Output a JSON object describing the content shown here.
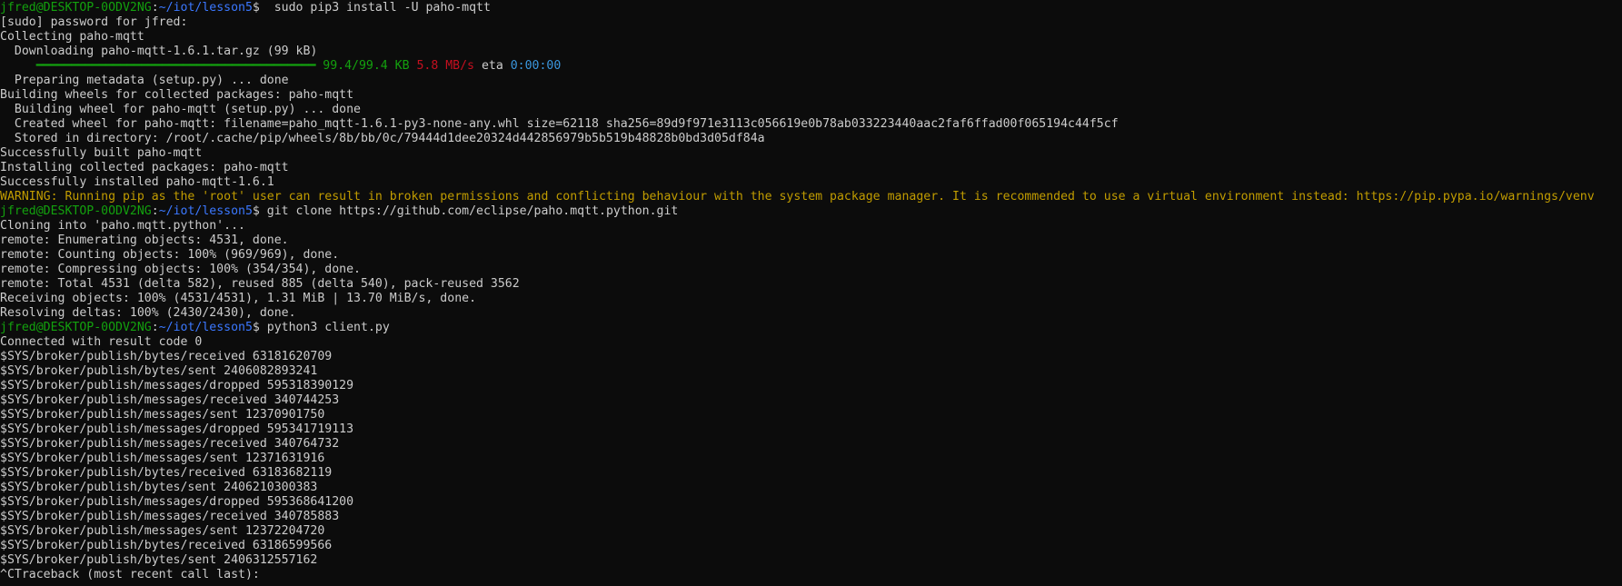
{
  "terminal": {
    "lines": [
      [
        {
          "t": "jfred@DESKTOP-0ODV2NG",
          "c": "green"
        },
        {
          "t": ":",
          "c": "default"
        },
        {
          "t": "~/iot/lesson5",
          "c": "blue"
        },
        {
          "t": "$  sudo pip3 install -U paho-mqtt",
          "c": "default"
        }
      ],
      [
        {
          "t": "[sudo] password for jfred:",
          "c": "default"
        }
      ],
      [
        {
          "t": "Collecting paho-mqtt",
          "c": "default"
        }
      ],
      [
        {
          "t": "  Downloading paho-mqtt-1.6.1.tar.gz (99 kB)",
          "c": "default"
        }
      ],
      [
        {
          "t": "     ",
          "c": "default"
        },
        {
          "t": "━━━━━━━━━━━━━━━━━━━━━━━━━━━━━━━━━━━━━━━━",
          "c": "bar"
        },
        {
          "t": " ",
          "c": "default"
        },
        {
          "t": "99.4/99.4 KB",
          "c": "green"
        },
        {
          "t": " ",
          "c": "default"
        },
        {
          "t": "5.8 MB/s",
          "c": "red"
        },
        {
          "t": " eta ",
          "c": "default"
        },
        {
          "t": "0:00:00",
          "c": "cyan"
        }
      ],
      [
        {
          "t": "  Preparing metadata (setup.py) ... done",
          "c": "default"
        }
      ],
      [
        {
          "t": "Building wheels for collected packages: paho-mqtt",
          "c": "default"
        }
      ],
      [
        {
          "t": "  Building wheel for paho-mqtt (setup.py) ... done",
          "c": "default"
        }
      ],
      [
        {
          "t": "  Created wheel for paho-mqtt: filename=paho_mqtt-1.6.1-py3-none-any.whl size=62118 sha256=89d9f971e3113c056619e0b78ab033223440aac2faf6ffad00f065194c44f5cf",
          "c": "default"
        }
      ],
      [
        {
          "t": "  Stored in directory: /root/.cache/pip/wheels/8b/bb/0c/79444d1dee20324d442856979b5b519b48828b0bd3d05df84a",
          "c": "default"
        }
      ],
      [
        {
          "t": "Successfully built paho-mqtt",
          "c": "default"
        }
      ],
      [
        {
          "t": "Installing collected packages: paho-mqtt",
          "c": "default"
        }
      ],
      [
        {
          "t": "Successfully installed paho-mqtt-1.6.1",
          "c": "default"
        }
      ],
      [
        {
          "t": "WARNING: Running pip as the 'root' user can result in broken permissions and conflicting behaviour with the system package manager. It is recommended to use a virtual environment instead: https://pip.pypa.io/warnings/venv",
          "c": "yellow"
        }
      ],
      [
        {
          "t": "jfred@DESKTOP-0ODV2NG",
          "c": "green"
        },
        {
          "t": ":",
          "c": "default"
        },
        {
          "t": "~/iot/lesson5",
          "c": "blue"
        },
        {
          "t": "$ git clone https://github.com/eclipse/paho.mqtt.python.git",
          "c": "default"
        }
      ],
      [
        {
          "t": "Cloning into 'paho.mqtt.python'...",
          "c": "default"
        }
      ],
      [
        {
          "t": "remote: Enumerating objects: 4531, done.",
          "c": "default"
        }
      ],
      [
        {
          "t": "remote: Counting objects: 100% (969/969), done.",
          "c": "default"
        }
      ],
      [
        {
          "t": "remote: Compressing objects: 100% (354/354), done.",
          "c": "default"
        }
      ],
      [
        {
          "t": "remote: Total 4531 (delta 582), reused 885 (delta 540), pack-reused 3562",
          "c": "default"
        }
      ],
      [
        {
          "t": "Receiving objects: 100% (4531/4531), 1.31 MiB | 13.70 MiB/s, done.",
          "c": "default"
        }
      ],
      [
        {
          "t": "Resolving deltas: 100% (2430/2430), done.",
          "c": "default"
        }
      ],
      [
        {
          "t": "jfred@DESKTOP-0ODV2NG",
          "c": "green"
        },
        {
          "t": ":",
          "c": "default"
        },
        {
          "t": "~/iot/lesson5",
          "c": "blue"
        },
        {
          "t": "$ python3 client.py",
          "c": "default"
        }
      ],
      [
        {
          "t": "Connected with result code 0",
          "c": "default"
        }
      ],
      [
        {
          "t": "$SYS/broker/publish/bytes/received 63181620709",
          "c": "default"
        }
      ],
      [
        {
          "t": "$SYS/broker/publish/bytes/sent 2406082893241",
          "c": "default"
        }
      ],
      [
        {
          "t": "$SYS/broker/publish/messages/dropped 595318390129",
          "c": "default"
        }
      ],
      [
        {
          "t": "$SYS/broker/publish/messages/received 340744253",
          "c": "default"
        }
      ],
      [
        {
          "t": "$SYS/broker/publish/messages/sent 12370901750",
          "c": "default"
        }
      ],
      [
        {
          "t": "$SYS/broker/publish/messages/dropped 595341719113",
          "c": "default"
        }
      ],
      [
        {
          "t": "$SYS/broker/publish/messages/received 340764732",
          "c": "default"
        }
      ],
      [
        {
          "t": "$SYS/broker/publish/messages/sent 12371631916",
          "c": "default"
        }
      ],
      [
        {
          "t": "$SYS/broker/publish/bytes/received 63183682119",
          "c": "default"
        }
      ],
      [
        {
          "t": "$SYS/broker/publish/bytes/sent 2406210300383",
          "c": "default"
        }
      ],
      [
        {
          "t": "$SYS/broker/publish/messages/dropped 595368641200",
          "c": "default"
        }
      ],
      [
        {
          "t": "$SYS/broker/publish/messages/received 340785883",
          "c": "default"
        }
      ],
      [
        {
          "t": "$SYS/broker/publish/messages/sent 12372204720",
          "c": "default"
        }
      ],
      [
        {
          "t": "$SYS/broker/publish/bytes/received 63186599566",
          "c": "default"
        }
      ],
      [
        {
          "t": "$SYS/broker/publish/bytes/sent 2406312557162",
          "c": "default"
        }
      ],
      [
        {
          "t": "^CTraceback (most recent call last):",
          "c": "default"
        }
      ]
    ]
  }
}
